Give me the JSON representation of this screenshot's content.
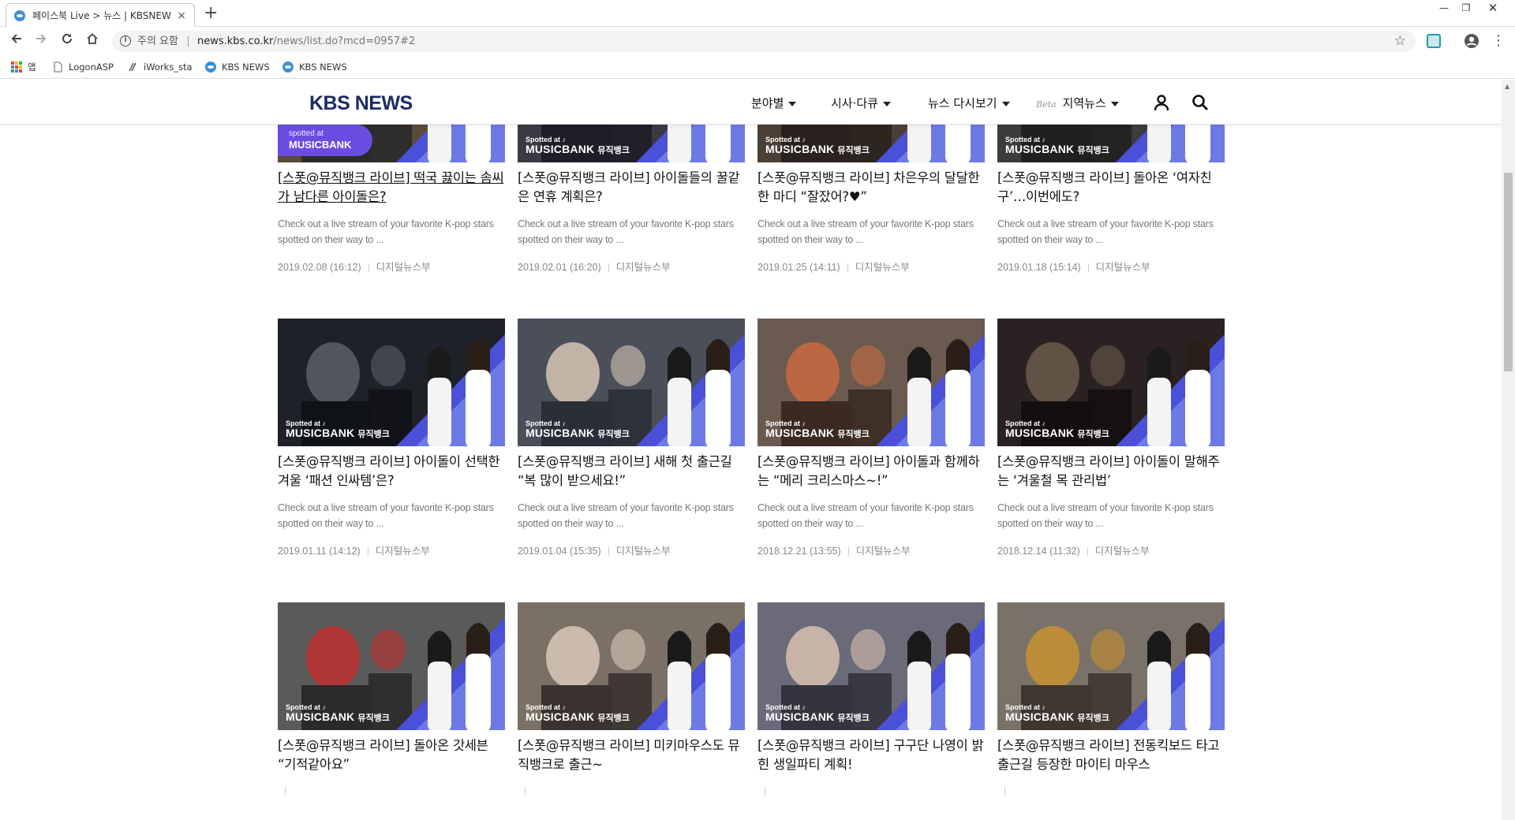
{
  "browser": {
    "tab_title": "페이스북 Live > 뉴스 | KBSNEWS",
    "tab_close": "×",
    "new_tab": "+",
    "security_label": "주의 요함",
    "url_host": "news.kbs.co.kr",
    "url_path": "/news/list.do?mcd=0957#2",
    "bookmarks": [
      "앱",
      "LogonASP",
      "iWorks_sta",
      "KBS NEWS",
      "KBS NEWS"
    ]
  },
  "site": {
    "logo": "KBS NEWS",
    "nav": [
      {
        "label": "분야별"
      },
      {
        "label": "시사·다큐"
      },
      {
        "label": "뉴스 다시보기"
      },
      {
        "beta": "Beta",
        "label": "지역뉴스"
      }
    ]
  },
  "articles": [
    {
      "title": "[스폿@뮤직뱅크 라이브] 떡국 끓이는 솜씨가 남다른 아이돌은?",
      "desc": "Check out a live stream of your favorite K-pop stars spotted on their way to ...",
      "date": "2019.02.08 (16:12)",
      "author": "디지털뉴스부",
      "badge": {
        "line1": "spotted at",
        "line2": "MUSICBANK",
        "line3": ""
      }
    },
    {
      "title": "[스폿@뮤직뱅크 라이브] 아이돌들의 꿀같은 연휴 계획은?",
      "desc": "Check out a live stream of your favorite K-pop stars spotted on their way to ...",
      "date": "2019.02.01 (16:20)",
      "author": "디지털뉴스부",
      "badge": {
        "line1": "Spotted at ♪",
        "line2": "MUSICBANK",
        "line3": "뮤직뱅크"
      }
    },
    {
      "title": "[스폿@뮤직뱅크 라이브] 차은우의 달달한 한 마디 “잘잤어?♥”",
      "desc": "Check out a live stream of your favorite K-pop stars spotted on their way to ...",
      "date": "2019.01.25 (14:11)",
      "author": "디지털뉴스부",
      "badge": {
        "line1": "Spotted at ♪",
        "line2": "MUSICBANK",
        "line3": "뮤직뱅크"
      }
    },
    {
      "title": "[스폿@뮤직뱅크 라이브] 돌아온 ‘여자친구’…이번에도?",
      "desc": "Check out a live stream of your favorite K-pop stars spotted on their way to ...",
      "date": "2019.01.18 (15:14)",
      "author": "디지털뉴스부",
      "badge": {
        "line1": "Spotted at ♪",
        "line2": "MUSICBANK",
        "line3": "뮤직뱅크"
      }
    },
    {
      "title": "[스폿@뮤직뱅크 라이브] 아이돌이 선택한 겨울 ‘패션 인싸템’은?",
      "desc": "Check out a live stream of your favorite K-pop stars spotted on their way to ...",
      "date": "2019.01.11 (14:12)",
      "author": "디지털뉴스부",
      "badge": {
        "line1": "Spotted at ♪",
        "line2": "MUSICBANK",
        "line3": "뮤직뱅크"
      }
    },
    {
      "title": "[스폿@뮤직뱅크 라이브] 새해 첫 출근길 “복 많이 받으세요!”",
      "desc": "Check out a live stream of your favorite K-pop stars spotted on their way to ...",
      "date": "2019.01.04 (15:35)",
      "author": "디지털뉴스부",
      "badge": {
        "line1": "Spotted at ♪",
        "line2": "MUSICBANK",
        "line3": "뮤직뱅크"
      }
    },
    {
      "title": "[스폿@뮤직뱅크 라이브] 아이돌과 함께하는 “메리 크리스마스~!”",
      "desc": "Check out a live stream of your favorite K-pop stars spotted on their way to ...",
      "date": "2018.12.21 (13:55)",
      "author": "디지털뉴스부",
      "badge": {
        "line1": "Spotted at ♪",
        "line2": "MUSICBANK",
        "line3": "뮤직뱅크"
      }
    },
    {
      "title": "[스폿@뮤직뱅크 라이브] 아이돌이 말해주는 ‘겨울철 목 관리법’",
      "desc": "Check out a live stream of your favorite K-pop stars spotted on their way to ...",
      "date": "2018.12.14 (11:32)",
      "author": "디지털뉴스부",
      "badge": {
        "line1": "Spotted at ♪",
        "line2": "MUSICBANK",
        "line3": "뮤직뱅크"
      }
    },
    {
      "title": "[스폿@뮤직뱅크 라이브] 돌아온 갓세븐 “기적같아요”",
      "desc": "",
      "date": "",
      "author": "",
      "badge": {
        "line1": "Spotted at ♪",
        "line2": "MUSICBANK",
        "line3": "뮤직뱅크"
      }
    },
    {
      "title": "[스폿@뮤직뱅크 라이브] 미키마우스도 뮤직뱅크로 출근~",
      "desc": "",
      "date": "",
      "author": "",
      "badge": {
        "line1": "Spotted at ♪",
        "line2": "MUSICBANK",
        "line3": "뮤직뱅크"
      }
    },
    {
      "title": "[스폿@뮤직뱅크 라이브] 구구단 나영이 밝힌 생일파티 계획!",
      "desc": "",
      "date": "",
      "author": "",
      "badge": {
        "line1": "Spotted at ♪",
        "line2": "MUSICBANK",
        "line3": "뮤직뱅크"
      }
    },
    {
      "title": "[스폿@뮤직뱅크 라이브] 전동킥보드 타고 출근길 등장한 마이티 마우스",
      "desc": "",
      "date": "",
      "author": "",
      "badge": {
        "line1": "Spotted at ♪",
        "line2": "MUSICBANK",
        "line3": "뮤직뱅크"
      }
    }
  ],
  "colors": {
    "logo": "#1b2b6b",
    "thumb_accent": "#4a50d8",
    "thumb_accent_light": "#8a9cf0"
  }
}
